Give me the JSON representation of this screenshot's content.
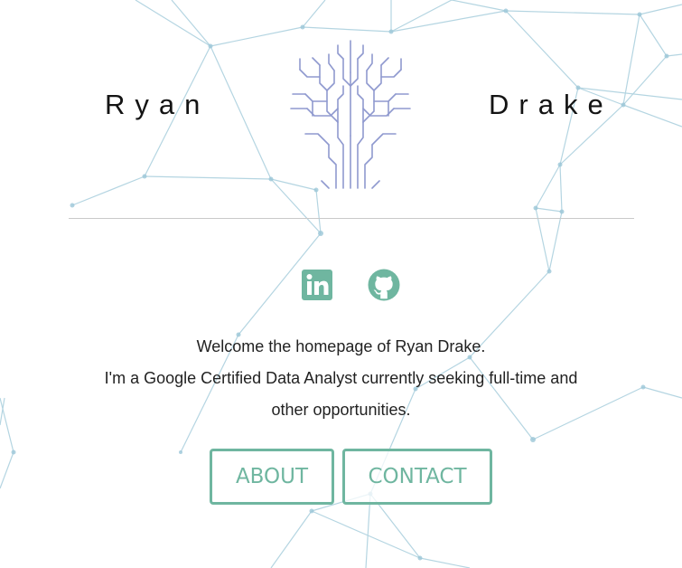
{
  "header": {
    "first_name": "Ryan",
    "last_name": "Drake"
  },
  "social": {
    "linkedin_icon": "linkedin-icon",
    "github_icon": "github-icon"
  },
  "intro": {
    "line1": "Welcome the homepage of Ryan Drake.",
    "line2": "I'm a Google Certified Data Analyst currently seeking full-time and",
    "line3": "other opportunities."
  },
  "buttons": {
    "about_label": "ABOUT",
    "contact_label": "CONTACT"
  },
  "colors": {
    "accent": "#6fb6a0",
    "logo": "#8f99cf",
    "network": "#9cc7d8"
  }
}
